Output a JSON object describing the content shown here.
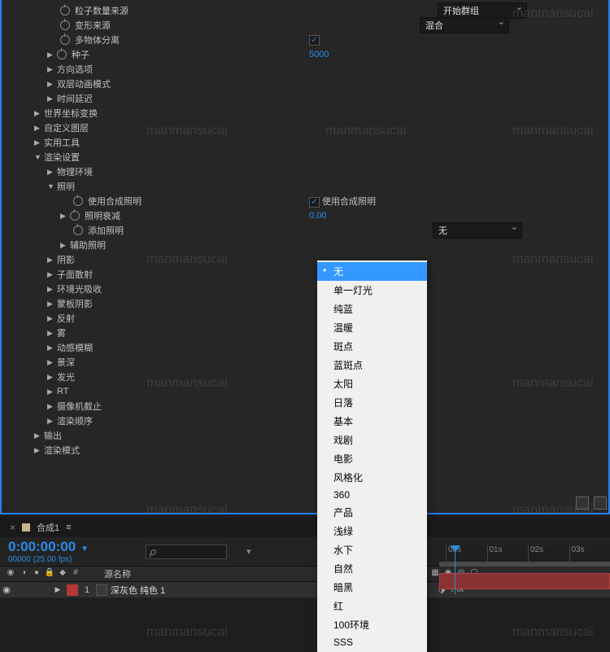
{
  "watermark": "manmansucai",
  "effects": {
    "particle_count_source": {
      "label": "粒子数量来源",
      "value": "开始群组"
    },
    "transform_source": {
      "label": "变形来源",
      "value": "混合"
    },
    "multi_object_separate": {
      "label": "多物体分离",
      "checked": true
    },
    "seed": {
      "label": "种子",
      "value": "5000"
    },
    "direction_options": "方向选项",
    "dual_anim_mode": "双层动画模式",
    "time_delay": "时间延迟",
    "world_transform": "世界坐标变换",
    "custom_layers": "自定义图层",
    "utilities": "实用工具",
    "render_settings": "渲染设置",
    "physics_env": "物理环境",
    "lighting": "照明",
    "use_comp_lighting": {
      "label": "使用合成照明",
      "check_label": "使用合成照明",
      "checked": true
    },
    "light_falloff": {
      "label": "照明衰减",
      "value": "0.00"
    },
    "add_lighting": {
      "label": "添加照明",
      "value": "无"
    },
    "aux_lighting": "辅助照明",
    "shadows": "阴影",
    "child_scatter": "子面散射",
    "ambient_occlusion": "环境光吸收",
    "matte_shadows": "蒙板阴影",
    "reflection": "反射",
    "fog": "雾",
    "motion_blur": "动感模糊",
    "dof": "景深",
    "glow": "发光",
    "rt": "RT",
    "camera_cutoff": "摄像机截止",
    "render_order": "渲染顺序",
    "output": "输出",
    "render_mode": "渲染模式"
  },
  "popup": {
    "items": [
      "无",
      "单一灯光",
      "纯蓝",
      "温暖",
      "斑点",
      "蓝斑点",
      "太阳",
      "日落",
      "基本",
      "戏剧",
      "电影",
      "风格化",
      "360",
      "产品",
      "浅绿",
      "水下",
      "自然",
      "暗黑",
      "红",
      "100环境",
      "SSS"
    ],
    "selected_index": 0
  },
  "timeline": {
    "comp_name": "合成1",
    "timecode": "0:00:00:00",
    "frame_info": "00000 (25.00 fps)",
    "source_name_header": "源名称",
    "search_placeholder": "𝜌",
    "layer": {
      "num": "1",
      "name": "深灰色 纯色 1",
      "fx": "/ fx"
    },
    "ticks": [
      "00s",
      "01s",
      "02s",
      "03s"
    ]
  }
}
